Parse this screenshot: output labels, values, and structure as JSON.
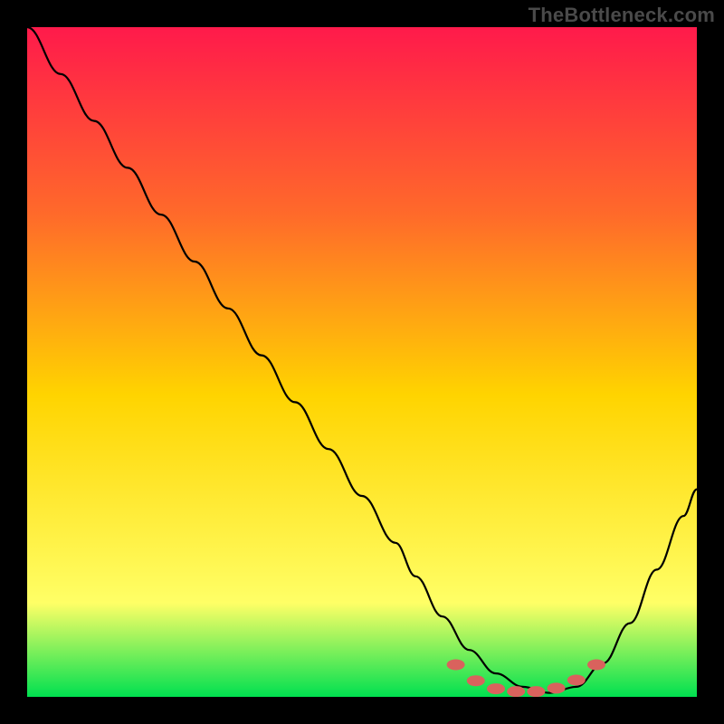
{
  "watermark": "TheBottleneck.com",
  "colors": {
    "gradient_top": "#ff1a4b",
    "gradient_mid1": "#ff6a2a",
    "gradient_mid2": "#ffd400",
    "gradient_mid3": "#ffff66",
    "gradient_bottom": "#00e050",
    "curve": "#000000",
    "marker": "#d9625d",
    "background": "#000000"
  },
  "chart_data": {
    "type": "line",
    "title": "",
    "xlabel": "",
    "ylabel": "",
    "xlim": [
      0,
      100
    ],
    "ylim": [
      0,
      100
    ],
    "grid": false,
    "legend": false,
    "series": [
      {
        "name": "bottleneck-curve",
        "x": [
          0,
          5,
          10,
          15,
          20,
          25,
          30,
          35,
          40,
          45,
          50,
          55,
          58,
          62,
          66,
          70,
          74,
          78,
          82,
          86,
          90,
          94,
          98,
          100
        ],
        "y": [
          100,
          93,
          86,
          79,
          72,
          65,
          58,
          51,
          44,
          37,
          30,
          23,
          18,
          12,
          7,
          3.5,
          1.5,
          0.6,
          1.5,
          5,
          11,
          19,
          27,
          31
        ]
      }
    ],
    "annotations": [
      {
        "name": "flat-bottom-markers",
        "type": "points",
        "x": [
          64,
          67,
          70,
          73,
          76,
          79,
          82,
          85
        ],
        "y": [
          4.8,
          2.4,
          1.2,
          0.8,
          0.8,
          1.3,
          2.5,
          4.8
        ]
      }
    ]
  }
}
